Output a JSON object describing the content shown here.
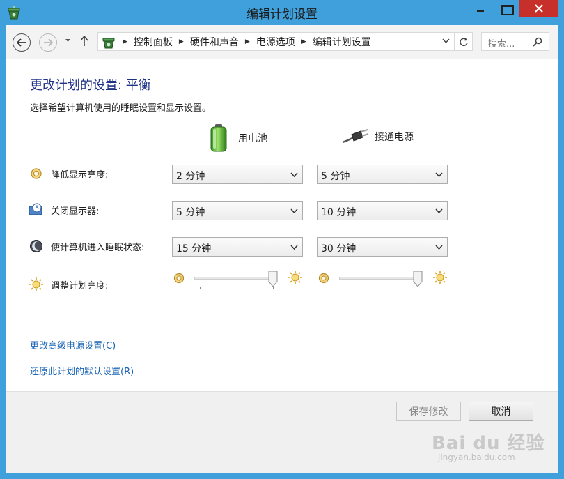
{
  "window": {
    "title": "编辑计划设置",
    "accent_color": "#3fa0db",
    "close_color": "#c7302a"
  },
  "address": {
    "breadcrumb": [
      "控制面板",
      "硬件和声音",
      "电源选项",
      "编辑计划设置"
    ],
    "search_placeholder": "搜索..."
  },
  "main": {
    "heading": "更改计划的设置: 平衡",
    "subtitle": "选择希望计算机使用的睡眠设置和显示设置。",
    "columns": {
      "battery": "用电池",
      "plugged": "接通电源"
    },
    "rows": [
      {
        "label": "降低显示亮度:",
        "icon": "dim-display-icon",
        "battery": "2 分钟",
        "plugged": "5 分钟"
      },
      {
        "label": "关闭显示器:",
        "icon": "display-off-icon",
        "battery": "5 分钟",
        "plugged": "10 分钟"
      },
      {
        "label": "使计算机进入睡眠状态:",
        "icon": "sleep-moon-icon",
        "battery": "15 分钟",
        "plugged": "30 分钟"
      }
    ],
    "brightness": {
      "label": "调整计划亮度:",
      "battery_level": 1.0,
      "plugged_level": 1.0
    },
    "links": {
      "advanced": "更改高级电源设置(C)",
      "restore": "还原此计划的默认设置(R)"
    }
  },
  "footer": {
    "save_label": "保存修改",
    "cancel_label": "取消",
    "link_color": "#1a64b4",
    "heading_color": "#1e3287"
  }
}
